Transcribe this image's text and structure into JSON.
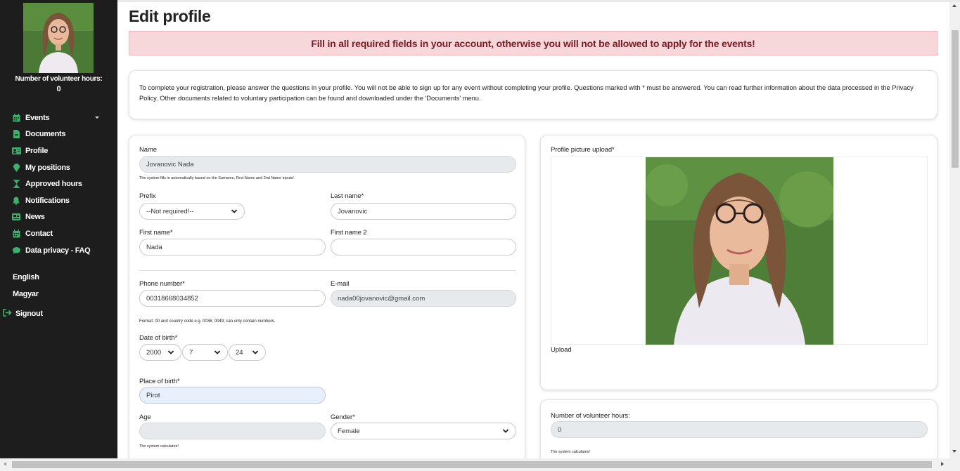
{
  "sidebar": {
    "volunteer_hours_label": "Number of volunteer hours:",
    "volunteer_hours_value": "0",
    "items": [
      {
        "label": "Events",
        "icon": "calendar-icon"
      },
      {
        "label": "Documents",
        "icon": "document-icon"
      },
      {
        "label": "Profile",
        "icon": "id-card-icon"
      },
      {
        "label": "My positions",
        "icon": "map-pin-icon"
      },
      {
        "label": "Approved hours",
        "icon": "hourglass-icon"
      },
      {
        "label": "Notifications",
        "icon": "bell-icon"
      },
      {
        "label": "News",
        "icon": "newspaper-icon"
      },
      {
        "label": "Contact",
        "icon": "calendar-icon"
      },
      {
        "label": "Data privacy - FAQ",
        "icon": "chat-icon"
      }
    ],
    "languages": [
      "English",
      "Magyar"
    ],
    "signout": "Signout",
    "accent": "#3ab26b"
  },
  "page": {
    "title": "Edit profile",
    "alert": "Fill in all required fields in your account, otherwise you will not be allowed to apply for the events!",
    "intro": "To complete your registration, please answer the questions in your profile. You will not be able to sign up for any event without completing your profile. Questions marked with *  must be answered. You can read further information about the data processed in the Privacy Policy. Other documents related to voluntary participation can be found and downloaded under the 'Documents' menu."
  },
  "form": {
    "name_label": "Name",
    "name_value": "Jovanovic Nada",
    "name_note": "The system fills in automatically based on the Surname, First Name and 2nd Name inputs!",
    "prefix_label": "Prefix",
    "prefix_value": "--Not required!--",
    "lastname_label": "Last name*",
    "lastname_value": "Jovanovic",
    "firstname_label": "First name*",
    "firstname_value": "Nada",
    "firstname2_label": "First name 2",
    "firstname2_value": "",
    "phone_label": "Phone number*",
    "phone_value": "00318668034852",
    "email_label": "E-mail",
    "email_value": "nada00jovanovic@gmail.com",
    "phone_note": "Format: 00 and country code e.g. 0036; 0049; can only contain numbers.",
    "dob_label": "Date of birth*",
    "dob_year": "2000",
    "dob_month": "7",
    "dob_day": "24",
    "pob_label": "Place of birth*",
    "pob_value": "Pirot",
    "age_label": "Age",
    "age_value": "",
    "age_note": "The system calculates!",
    "gender_label": "Gender*",
    "gender_value": "Female"
  },
  "picture": {
    "label": "Profile picture upload*",
    "upload": "Upload"
  },
  "hours": {
    "label": "Number of volunteer hours:",
    "value": "0",
    "note": "The system calculates!"
  }
}
